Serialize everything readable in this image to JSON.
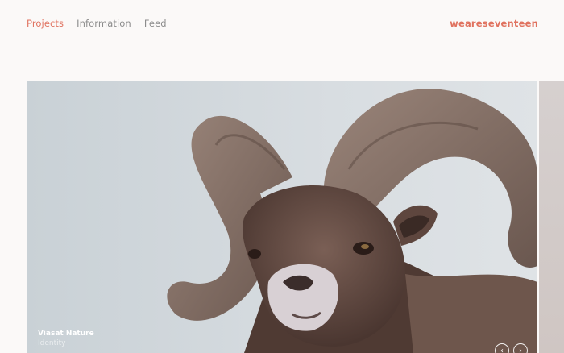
{
  "nav": {
    "items": [
      {
        "label": "Projects",
        "active": true
      },
      {
        "label": "Information",
        "active": false
      },
      {
        "label": "Feed",
        "active": false
      }
    ]
  },
  "brand": {
    "logo": "weareseventeen",
    "accent": "#e0725f"
  },
  "hero": {
    "title": "Viasat Nature",
    "subtitle": "Identity",
    "image": "bighorn-ram-photo"
  },
  "controls": {
    "prev_icon": "chevron-left-icon",
    "next_icon": "chevron-right-icon",
    "prev_glyph": "‹",
    "next_glyph": "›"
  }
}
